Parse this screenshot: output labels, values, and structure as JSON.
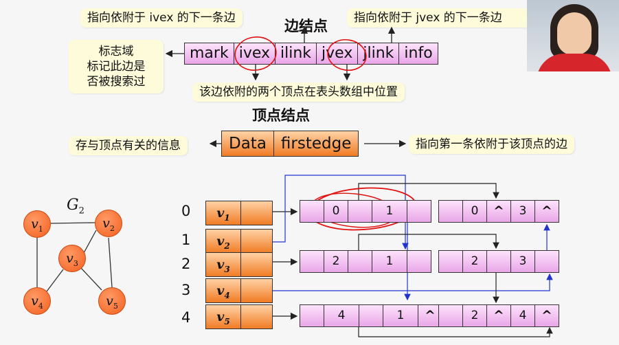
{
  "edge_section": {
    "heading": "边结点",
    "ivex_callout": "指向依附于 ivex 的下一条边",
    "jvex_callout": "指向依附于 jvex 的下一条边",
    "mark_callout": [
      "标志域",
      "标记此边是",
      "否被搜索过"
    ],
    "vertices_callout": "该边依附的两个顶点在表头数组中位置",
    "fields": [
      "mark",
      "ivex",
      "ilink",
      "jvex",
      "jlink",
      "info"
    ]
  },
  "vertex_section": {
    "heading": "顶点结点",
    "data_callout": "存与顶点有关的信息",
    "firstedge_callout": "指向第一条依附于该顶点的边",
    "fields": [
      "Data",
      "firstedge"
    ]
  },
  "graph": {
    "title": "G",
    "title_sub": "2",
    "vertex_letter": "v",
    "vertices": [
      "1",
      "2",
      "3",
      "4",
      "5"
    ]
  },
  "head_array": [
    {
      "index": "0",
      "sub": "1"
    },
    {
      "index": "1",
      "sub": "2"
    },
    {
      "index": "2",
      "sub": "3"
    },
    {
      "index": "3",
      "sub": "4"
    },
    {
      "index": "4",
      "sub": "5"
    }
  ],
  "edge_nodes": {
    "e01": [
      "",
      "0",
      "",
      "1",
      ""
    ],
    "e03": [
      "",
      "0",
      "^",
      "3",
      "^"
    ],
    "e21": [
      "",
      "2",
      "",
      "1",
      ""
    ],
    "e23": [
      "",
      "2",
      "",
      "3",
      ""
    ],
    "e41": [
      "",
      "4",
      "",
      "1",
      "^"
    ],
    "e24": [
      "",
      "2",
      "^",
      "4",
      "^"
    ]
  },
  "colors": {
    "edge_node": "#e9a6e8",
    "vertex_node": "#f07b24",
    "callout": "#fdfbd9",
    "pointer_blue": "#2233cc",
    "annotation_red": "#e01010"
  }
}
